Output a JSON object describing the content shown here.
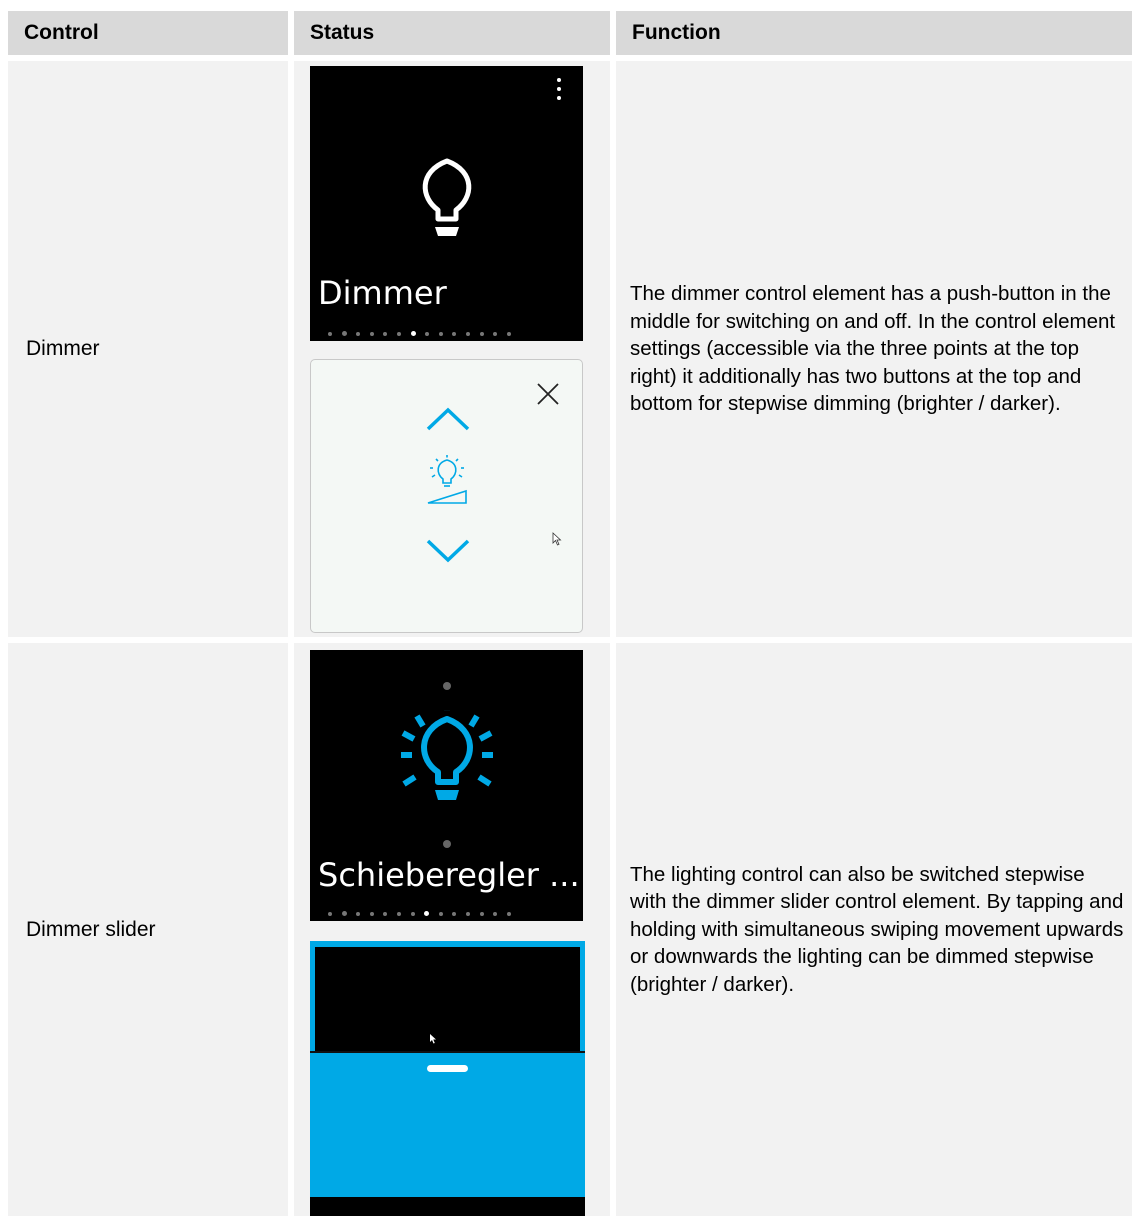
{
  "table": {
    "headers": {
      "control": "Control",
      "status": "Status",
      "function": "Function"
    },
    "rows": [
      {
        "control": "Dimmer",
        "screen_title": "Dimmer",
        "function": "The dimmer control element has a push-button in the middle for switching on and off. In the control element settings (accessible via the three points at the top right) it additionally has two buttons at the top and bottom for stepwise dimming (brighter / darker)."
      },
      {
        "control": "Dimmer slider",
        "screen_title": "Schieberegler ...",
        "function": "The lighting control can also be switched stepwise with the dimmer slider control element. By tapping and holding with simultaneous swiping movement upwards or downwards the lighting can be dimmed stepwise (brighter / darker)."
      }
    ]
  },
  "colors": {
    "accent": "#00a9e6",
    "header_bg": "#d9d9d9",
    "cell_bg": "#f2f2f2"
  },
  "icons": [
    "bulb-icon",
    "more-vert-icon",
    "close-icon",
    "chevron-up-icon",
    "chevron-down-icon",
    "dimmer-bulb-icon",
    "bulb-on-icon",
    "cursor-icon",
    "slider-handle-icon"
  ]
}
